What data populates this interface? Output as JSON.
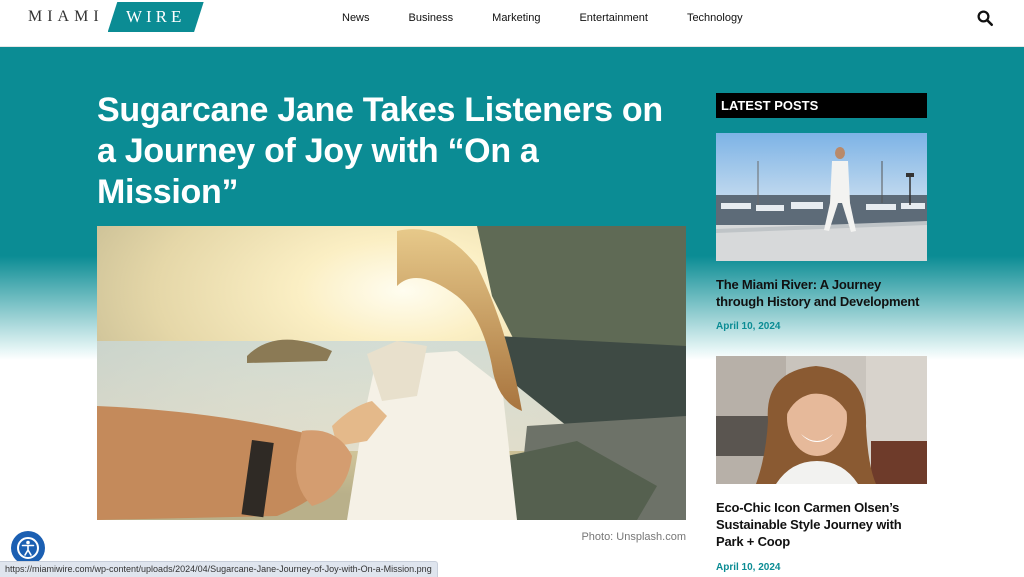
{
  "header": {
    "logo": {
      "part1": "MIAMI",
      "part2": "WIRE"
    },
    "nav": [
      "News",
      "Business",
      "Marketing",
      "Entertainment",
      "Technology"
    ],
    "search_icon": "search-icon"
  },
  "article": {
    "title": "Sugarcane Jane Takes Listeners on a Journey of Joy with “On a Mission”",
    "photo_credit": "Photo: Unsplash.com"
  },
  "sidebar": {
    "heading": "LATEST POSTS",
    "posts": [
      {
        "title": "The Miami River: A Journey through History and Development",
        "date": "April 10, 2024"
      },
      {
        "title": "Eco-Chic Icon Carmen Olsen’s Sustainable Style Journey with Park + Coop",
        "date": "April 10, 2024"
      }
    ]
  },
  "status_bar": {
    "url": "https://miamiwire.com/wp-content/uploads/2024/04/Sugarcane-Jane-Journey-of-Joy-with-On-a-Mission.png"
  },
  "colors": {
    "accent": "#0b8c94",
    "band": "#0b8c94",
    "date": "#0b8c94"
  }
}
